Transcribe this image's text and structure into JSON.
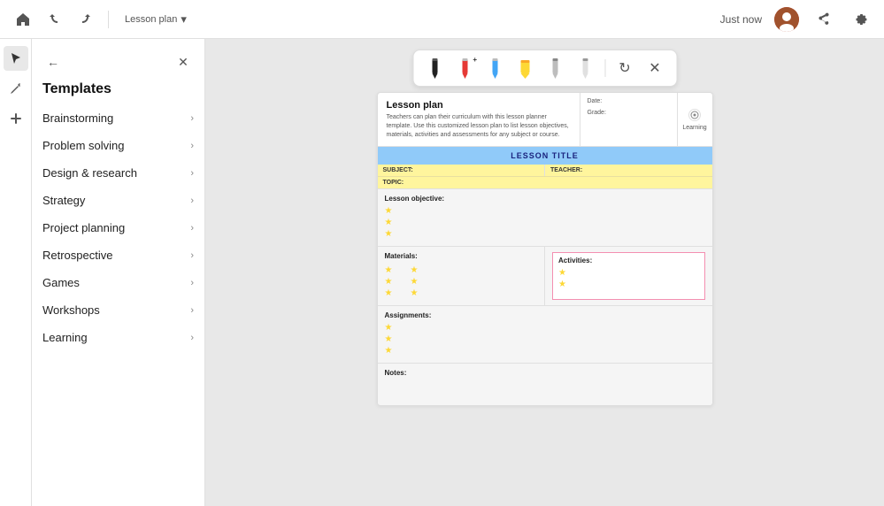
{
  "topbar": {
    "title": "Lesson plan",
    "time": "Just now",
    "home_label": "Home",
    "undo_label": "Undo",
    "redo_label": "Redo",
    "dropdown_icon": "▾",
    "share_label": "Share",
    "settings_label": "Settings"
  },
  "sidebar": {
    "title": "Templates",
    "items": [
      {
        "id": "brainstorming",
        "label": "Brainstorming"
      },
      {
        "id": "problem-solving",
        "label": "Problem solving"
      },
      {
        "id": "design-research",
        "label": "Design & research"
      },
      {
        "id": "strategy",
        "label": "Strategy"
      },
      {
        "id": "project-planning",
        "label": "Project planning"
      },
      {
        "id": "retrospective",
        "label": "Retrospective"
      },
      {
        "id": "games",
        "label": "Games"
      },
      {
        "id": "workshops",
        "label": "Workshops"
      },
      {
        "id": "learning",
        "label": "Learning"
      }
    ]
  },
  "drawing_toolbar": {
    "tools": [
      {
        "id": "pen-black",
        "label": "Black pen",
        "symbol": "✏️"
      },
      {
        "id": "pen-red",
        "label": "Red pen",
        "symbol": "🖊"
      },
      {
        "id": "pen-blue",
        "label": "Blue pen",
        "symbol": "🖊"
      },
      {
        "id": "highlighter-yellow",
        "label": "Yellow highlighter",
        "symbol": "🖍"
      },
      {
        "id": "pen-gray1",
        "label": "Gray pen 1",
        "symbol": "🖊"
      },
      {
        "id": "pen-gray2",
        "label": "Gray pen 2",
        "symbol": "🖊"
      }
    ],
    "close_label": "×",
    "refresh_label": "↺"
  },
  "template": {
    "title": "Lesson plan",
    "description": "Teachers can plan their curriculum with this lesson planner template. Use this customized lesson plan to list lesson objectives, materials, activities and assessments for any subject or course.",
    "date_label": "Date:",
    "grade_label": "Grade:",
    "badge_label": "Learning",
    "lesson_title_text": "LESSON TITLE",
    "subject_label": "SUBJECT:",
    "teacher_label": "TEACHER:",
    "topic_label": "TOPIC:",
    "objective_label": "Lesson objective:",
    "materials_label": "Materials:",
    "activities_label": "Activities:",
    "assignments_label": "Assignments:",
    "notes_label": "Notes:",
    "stars": [
      "★",
      "★",
      "★"
    ]
  }
}
